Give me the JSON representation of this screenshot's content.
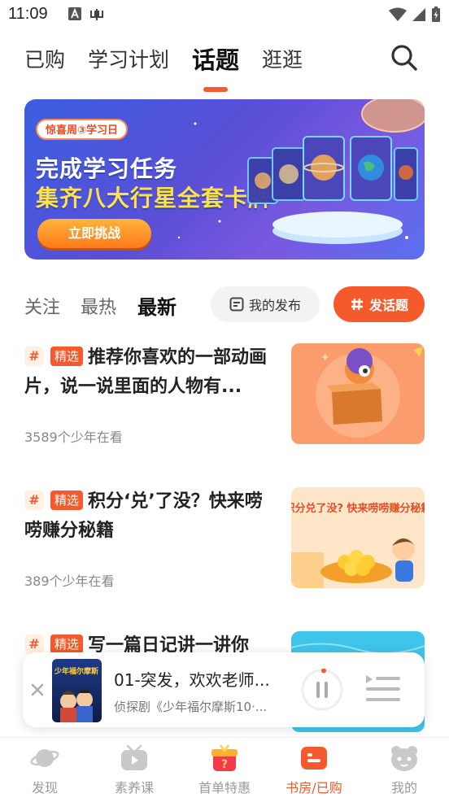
{
  "status_bar": {
    "time": "11:09"
  },
  "top_tabs": [
    {
      "label": "已购",
      "active": false
    },
    {
      "label": "学习计划",
      "active": false
    },
    {
      "label": "话题",
      "active": true
    },
    {
      "label": "逛逛",
      "active": false
    }
  ],
  "banner": {
    "tag": "惊喜周③学习日",
    "line1": "完成学习任务",
    "line2": "集齐八大行星全套卡牌",
    "button_label": "立即挑战"
  },
  "filter_tabs": [
    {
      "label": "关注",
      "active": false
    },
    {
      "label": "最热",
      "active": false
    },
    {
      "label": "最新",
      "active": true
    }
  ],
  "my_posts_label": "我的发布",
  "new_topic_label": "发话题",
  "topics": [
    {
      "badge": "精选",
      "title": "推荐你喜欢的一部动画片，说一说里面的人物有...",
      "viewers": "3589个少年在看",
      "thumb_text": ""
    },
    {
      "badge": "精选",
      "title": "积分‘兑’了没？快来唠唠赚分秘籍",
      "viewers": "389个少年在看",
      "thumb_text": "积分兑了没? 快来唠唠赚分秘籍"
    },
    {
      "badge": "精选",
      "title": "写一篇日记讲一讲你",
      "viewers": "",
      "thumb_text": ""
    }
  ],
  "player": {
    "title": "01-突发，欢欢老师...",
    "subtitle": "侦探剧《少年福尔摩斯10·...",
    "cover_text": "少年福尔摩斯"
  },
  "bottom_nav": [
    {
      "label": "发现",
      "active": false
    },
    {
      "label": "素养课",
      "active": false
    },
    {
      "label": "首单特惠",
      "active": false
    },
    {
      "label": "书房/已购",
      "active": true
    },
    {
      "label": "我的",
      "active": false
    }
  ],
  "colors": {
    "accent": "#f55a2c",
    "banner_bg": "#4a5be0"
  }
}
